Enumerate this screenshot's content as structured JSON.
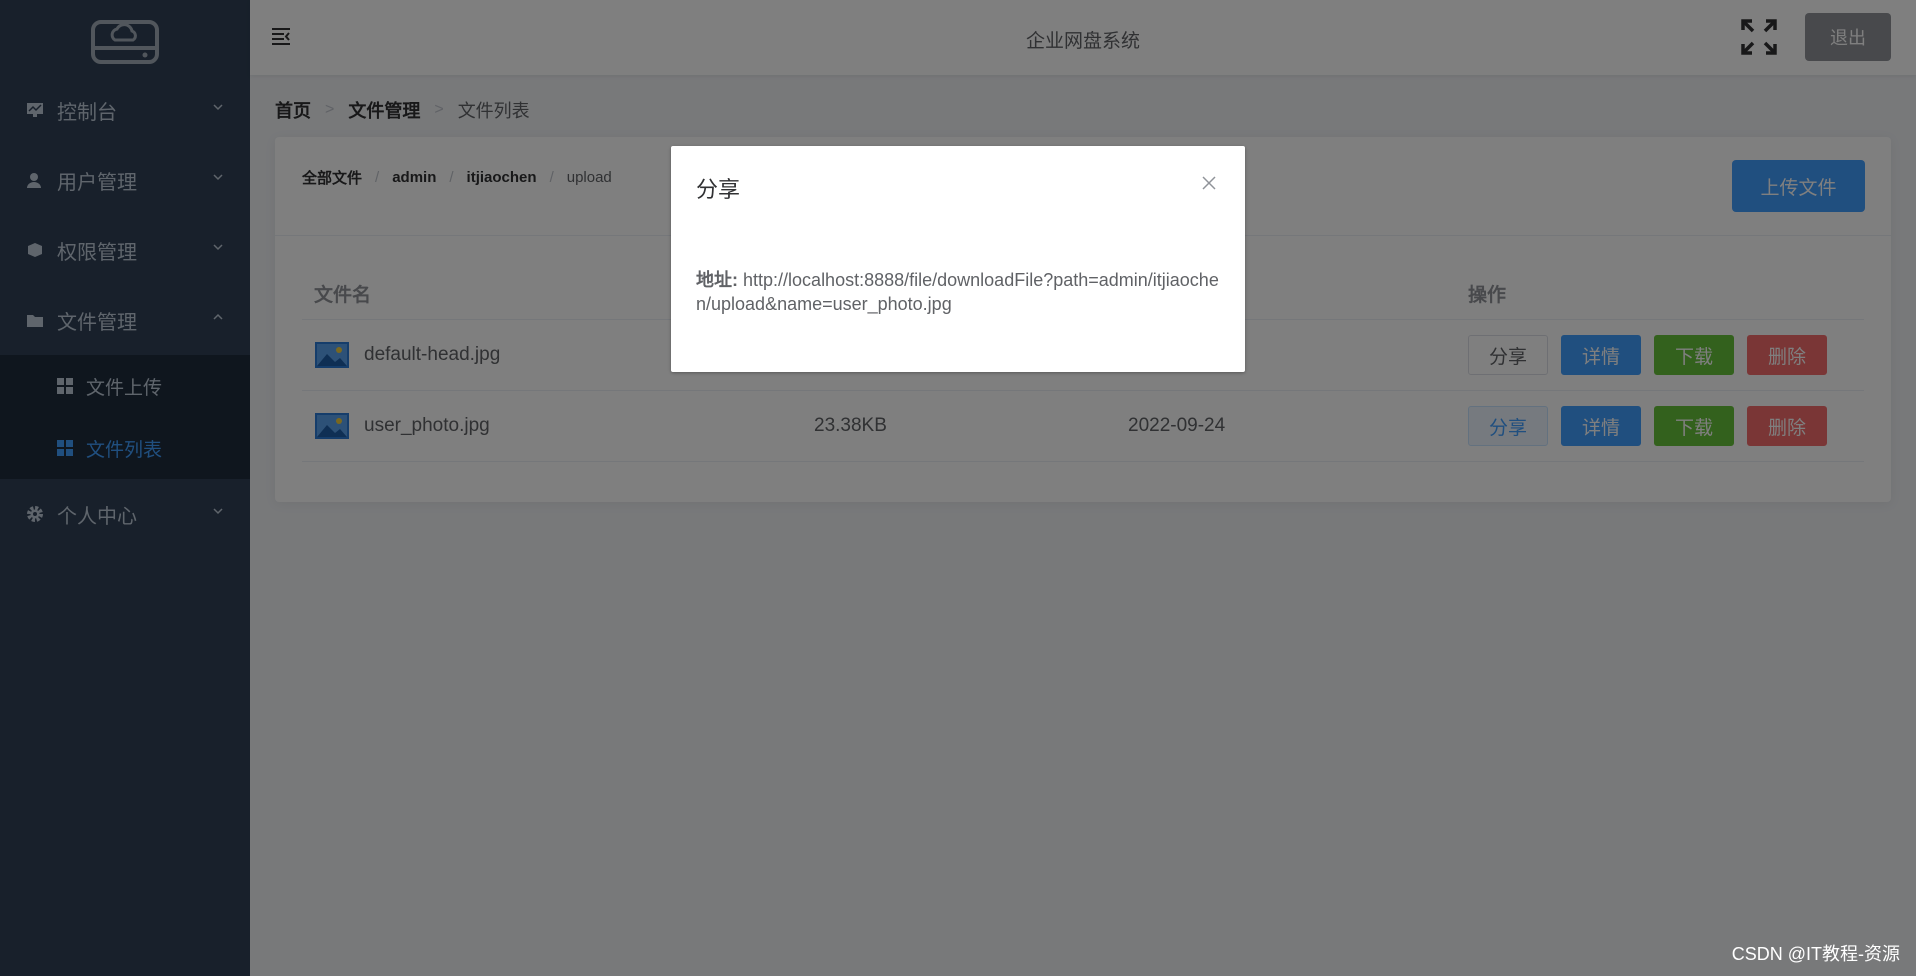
{
  "header": {
    "title": "企业网盘系统",
    "logout_label": "退出"
  },
  "sidebar": {
    "items": [
      {
        "label": "控制台",
        "icon": "monitor-icon"
      },
      {
        "label": "用户管理",
        "icon": "user-icon"
      },
      {
        "label": "权限管理",
        "icon": "shield-icon"
      },
      {
        "label": "文件管理",
        "icon": "folder-icon",
        "expanded": true,
        "children": [
          {
            "label": "文件上传",
            "icon": "grid-icon"
          },
          {
            "label": "文件列表",
            "icon": "grid-icon",
            "active": true
          }
        ]
      },
      {
        "label": "个人中心",
        "icon": "gear-icon"
      }
    ]
  },
  "breadcrumb": [
    "首页",
    "文件管理",
    "文件列表"
  ],
  "path_bar": [
    "全部文件",
    "admin",
    "itjiaochen",
    "upload"
  ],
  "upload_label": "上传文件",
  "table": {
    "columns": [
      "文件名",
      "",
      "",
      "操作"
    ],
    "rows": [
      {
        "name": "default-head.jpg",
        "size": "",
        "date": ""
      },
      {
        "name": "user_photo.jpg",
        "size": "23.38KB",
        "date": "2022-09-24"
      }
    ],
    "actions": [
      "分享",
      "详情",
      "下载",
      "删除"
    ]
  },
  "dialog": {
    "title": "分享",
    "address_label": "地址:",
    "address_value": "http://localhost:8888/file/downloadFile?path=admin/itjiaochen/upload&name=user_photo.jpg"
  },
  "watermark": "CSDN @IT教程-资源",
  "colors": {
    "sidebar_bg": "#304156",
    "primary": "#409eff",
    "success": "#67c23a",
    "danger": "#f56c6c",
    "info": "#909399"
  }
}
